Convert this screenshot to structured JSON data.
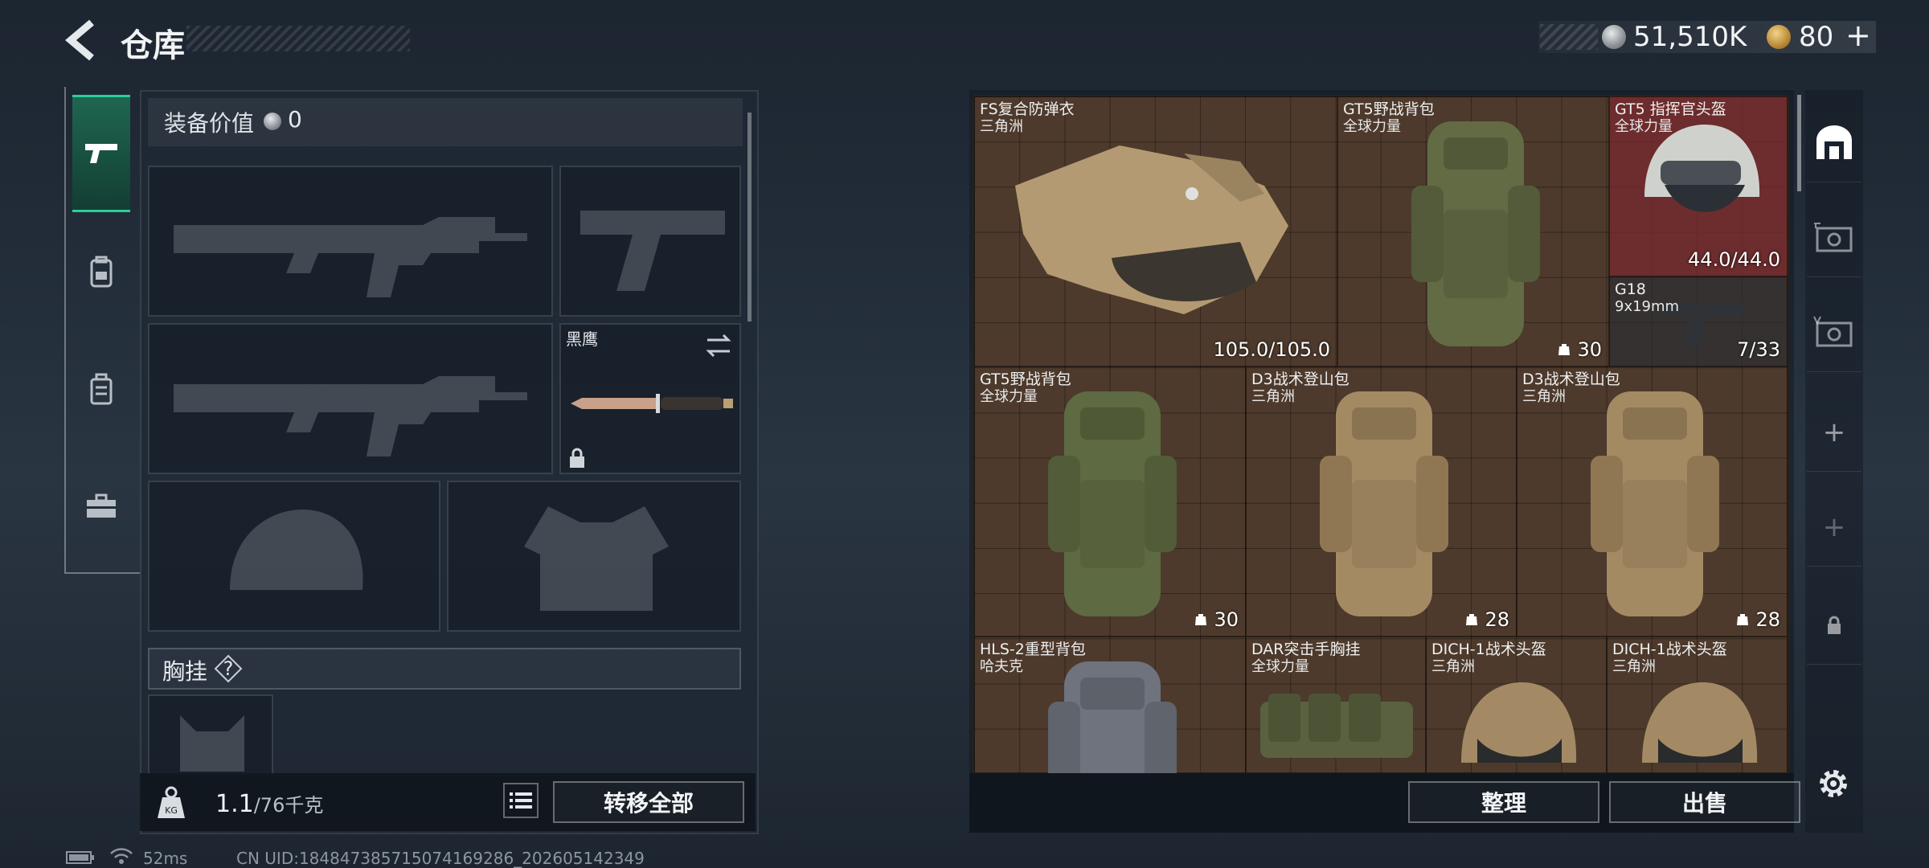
{
  "header": {
    "title": "仓库",
    "money": "51,510K",
    "tokens": "80",
    "plus": "+"
  },
  "equipment": {
    "value_label": "装备价值",
    "value": "0",
    "knife_name": "黑鹰",
    "vest_label": "胸挂",
    "help": "?",
    "weight_current": "1.1",
    "weight_max": "/76千克",
    "transfer_all": "转移全部"
  },
  "status": {
    "ping": "52ms",
    "uid": "CN UID:184847385715074169286_202605142349"
  },
  "stash": {
    "items": [
      {
        "name": "FS复合防弹衣",
        "sub": "三角洲",
        "value": "105.0/105.0"
      },
      {
        "name": "GT5野战背包",
        "sub": "全球力量",
        "value": "30"
      },
      {
        "name": "GT5 指挥官头盔",
        "sub": "全球力量",
        "value": "44.0/44.0"
      },
      {
        "name": "G18",
        "sub": "9x19mm",
        "value": "7/33"
      },
      {
        "name": "GT5野战背包",
        "sub": "全球力量",
        "value": "30"
      },
      {
        "name": "D3战术登山包",
        "sub": "三角洲",
        "value": "28"
      },
      {
        "name": "D3战术登山包",
        "sub": "三角洲",
        "value": "28"
      },
      {
        "name": "HLS-2重型背包",
        "sub": "哈夫克"
      },
      {
        "name": "DAR突击手胸挂",
        "sub": "全球力量"
      },
      {
        "name": "DICH-1战术头盔",
        "sub": "三角洲"
      },
      {
        "name": "DICH-1战术头盔",
        "sub": "三角洲"
      }
    ],
    "sort": "整理",
    "sell": "出售"
  },
  "right_tabs": {
    "plus": "+",
    "plus2": "+"
  },
  "colors": {
    "accent": "#2ccf96",
    "stash_bg": "#4d3a2c",
    "helmet_highlight": "#782830"
  },
  "icons": [
    "back-arrow-icon",
    "silver-coin-icon",
    "gold-token-icon",
    "pistol-icon",
    "backpack-tab-icon",
    "rig-tab-icon",
    "toolbox-icon",
    "weight-icon",
    "list-icon",
    "swap-icon",
    "lock-icon",
    "battery-icon",
    "wifi-icon",
    "storage-icon",
    "gear-icon"
  ]
}
